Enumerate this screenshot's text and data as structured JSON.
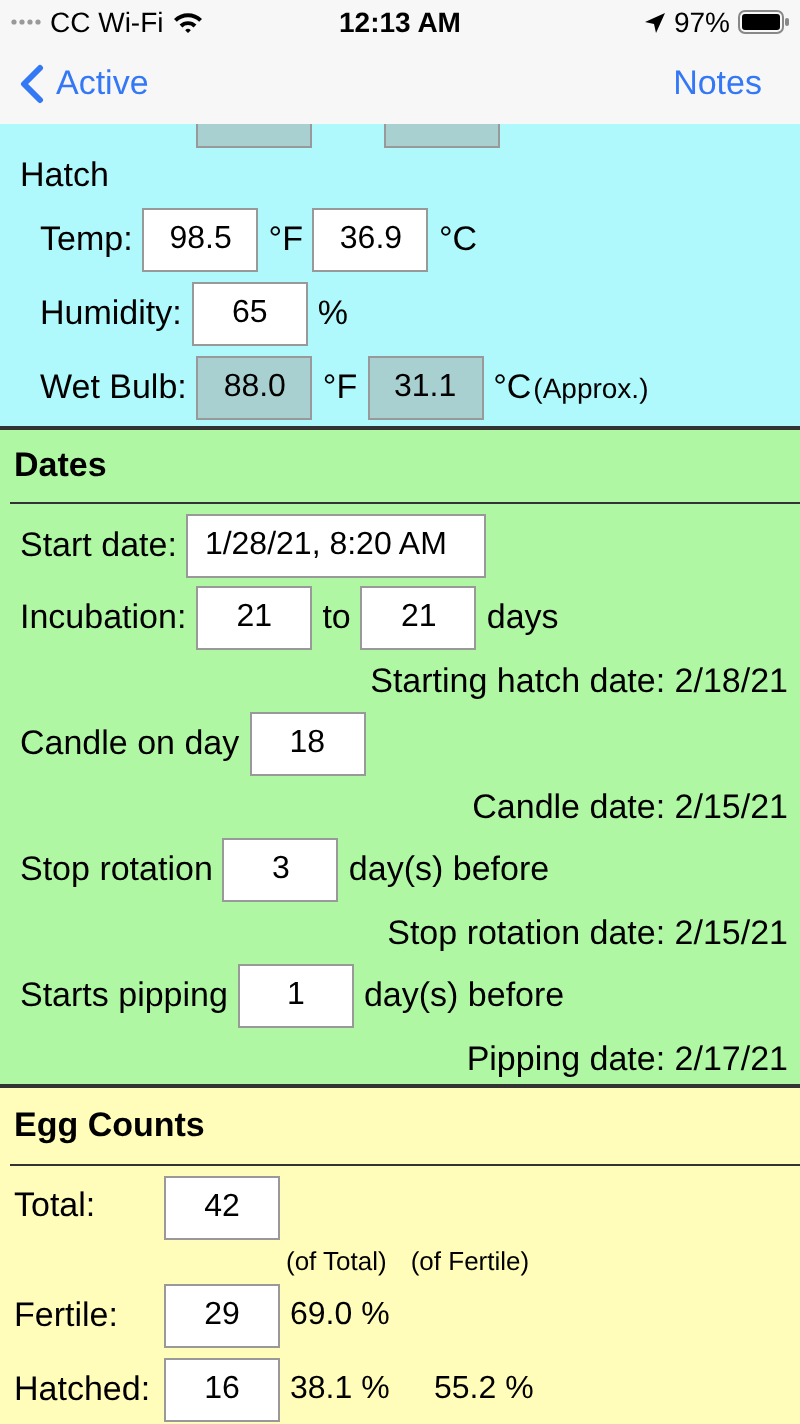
{
  "status_bar": {
    "carrier": "CC Wi-Fi",
    "time": "12:13 AM",
    "battery": "97%"
  },
  "nav_bar": {
    "back": "Active",
    "right": "Notes"
  },
  "hatch": {
    "partial_fields": [
      {
        "readonly": true
      },
      {
        "readonly": true
      }
    ],
    "title": "Hatch",
    "rows": [
      {
        "label": "Temp:",
        "parts": [
          {
            "kind": "field",
            "value": "98.5",
            "readonly": false
          },
          {
            "kind": "unit",
            "text": "°F"
          },
          {
            "kind": "field",
            "value": "36.9",
            "readonly": false
          },
          {
            "kind": "unit",
            "text": "°C"
          }
        ]
      },
      {
        "label": "Humidity:",
        "parts": [
          {
            "kind": "field",
            "value": "65",
            "readonly": false
          },
          {
            "kind": "unit",
            "text": "%"
          }
        ]
      },
      {
        "label": "Wet Bulb:",
        "parts": [
          {
            "kind": "field",
            "value": "88.0",
            "readonly": true
          },
          {
            "kind": "unit",
            "text": "°F"
          },
          {
            "kind": "field",
            "value": "31.1",
            "readonly": true
          },
          {
            "kind": "unit",
            "text": "°C"
          },
          {
            "kind": "note",
            "text": "(Approx.)"
          }
        ]
      }
    ]
  },
  "dates": {
    "title": "Dates",
    "items": [
      {
        "kind": "row",
        "label": "Start date:",
        "parts": [
          {
            "kind": "wide_field",
            "value": "1/28/21, 8:20 AM",
            "readonly": false
          }
        ]
      },
      {
        "kind": "row",
        "label": "Incubation:",
        "parts": [
          {
            "kind": "field",
            "value": "21",
            "readonly": false
          },
          {
            "kind": "unit",
            "text": "to"
          },
          {
            "kind": "field",
            "value": "21",
            "readonly": false
          },
          {
            "kind": "unit",
            "text": "days"
          }
        ]
      },
      {
        "kind": "result",
        "text": "Starting hatch date: 2/18/21"
      },
      {
        "kind": "row",
        "label": "Candle on day",
        "parts": [
          {
            "kind": "field",
            "value": "18",
            "readonly": false
          }
        ]
      },
      {
        "kind": "result",
        "text": "Candle date: 2/15/21"
      },
      {
        "kind": "row",
        "label": "Stop rotation",
        "parts": [
          {
            "kind": "field",
            "value": "3",
            "readonly": false
          },
          {
            "kind": "unit",
            "text": "day(s) before"
          }
        ]
      },
      {
        "kind": "result",
        "text": "Stop rotation date: 2/15/21"
      },
      {
        "kind": "row",
        "label": "Starts pipping",
        "parts": [
          {
            "kind": "field",
            "value": "1",
            "readonly": false
          },
          {
            "kind": "unit",
            "text": "day(s) before"
          }
        ]
      },
      {
        "kind": "result",
        "text": "Pipping date: 2/17/21"
      }
    ]
  },
  "egg_counts": {
    "title": "Egg Counts",
    "column_headers": [
      "(of Total)",
      "(of Fertile)"
    ],
    "rows": [
      {
        "label": "Total:",
        "value": "42",
        "percents": []
      },
      {
        "label": "Fertile:",
        "value": "29",
        "percents": [
          "69.0 %"
        ]
      },
      {
        "label": "Hatched:",
        "value": "16",
        "percents": [
          "38.1 %",
          "55.2 %"
        ]
      }
    ]
  }
}
